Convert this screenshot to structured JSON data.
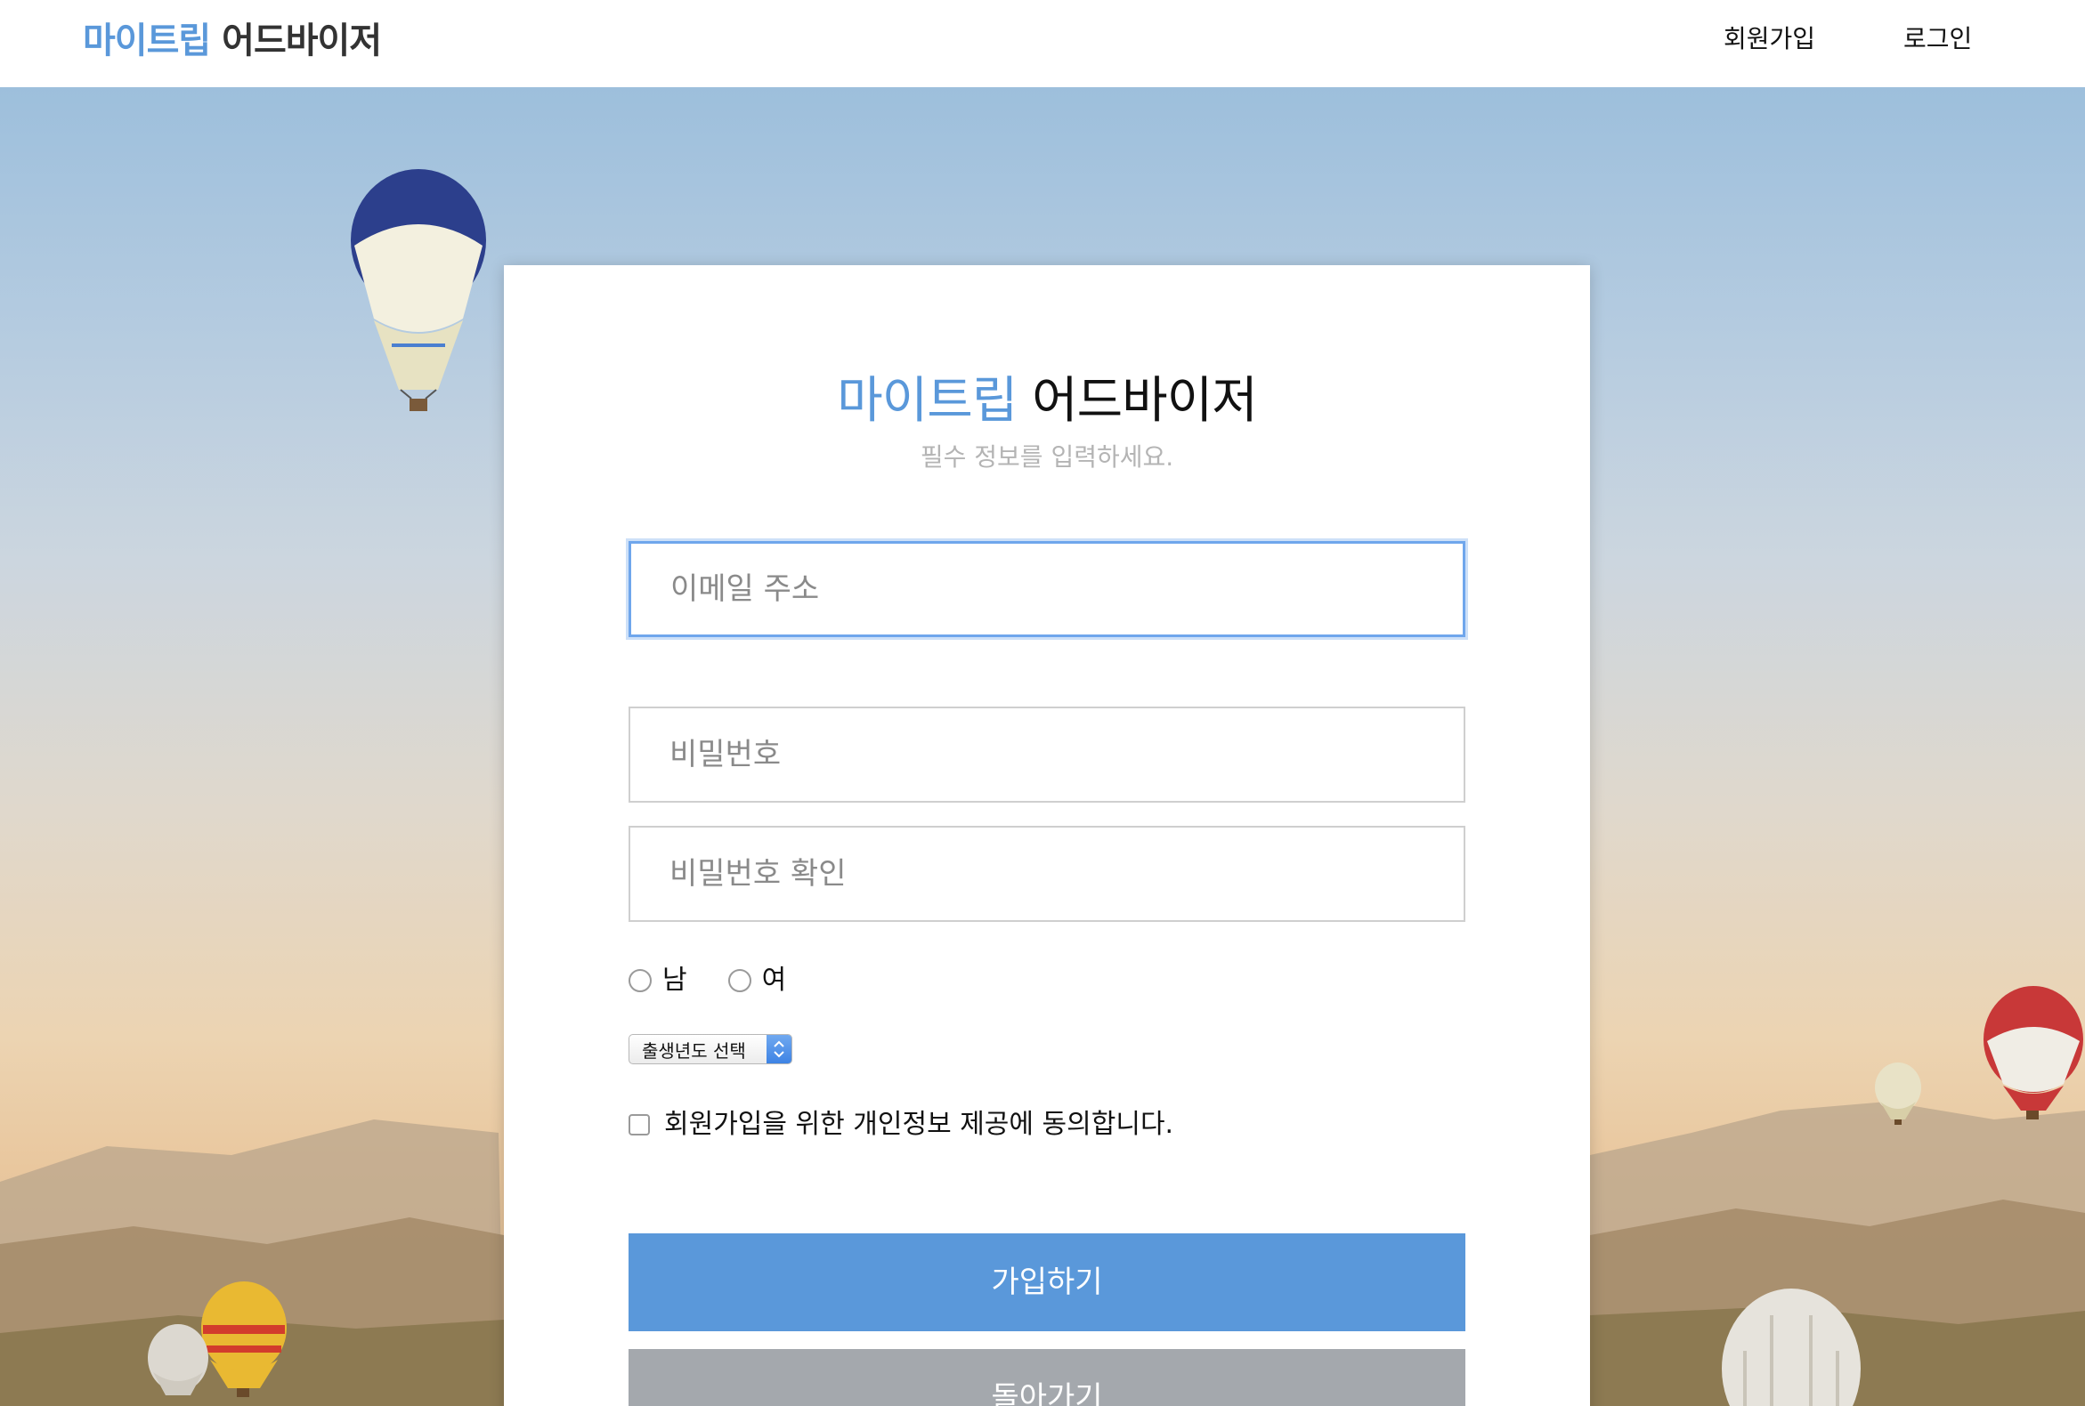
{
  "header": {
    "logo_accent": "마이트립",
    "logo_rest": "어드바이저",
    "nav": {
      "signup_label": "회원가입",
      "login_label": "로그인"
    }
  },
  "card": {
    "title_accent": "마이트립",
    "title_rest": "어드바이저",
    "subtitle": "필수 정보를 입력하세요.",
    "email_placeholder": "이메일 주소",
    "password_placeholder": "비밀번호",
    "password_confirm_placeholder": "비밀번호 확인",
    "gender_options": [
      "남",
      "여"
    ],
    "birth_year_select": "출생년도 선택",
    "agree_label": "회원가입을 위한 개인정보 제공에 동의합니다.",
    "signup_button": "가입하기",
    "back_button": "돌아가기"
  },
  "colors": {
    "accent": "#5a98da",
    "secondary_button": "#a4a8ad",
    "subtitle": "#b4b4b4"
  }
}
